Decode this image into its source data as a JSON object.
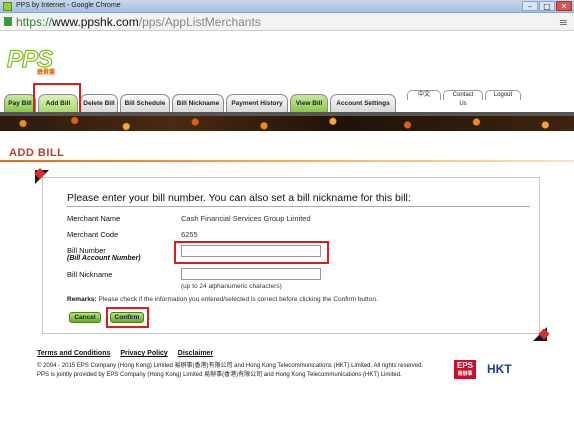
{
  "browser": {
    "window_title": "PPS by Internet - Google Chrome",
    "url_scheme": "https://",
    "url_host": "www.ppshk.com",
    "url_path": "/pps/AppListMerchants",
    "minimize": "–",
    "maximize": "□",
    "close": "✕"
  },
  "logo": {
    "text": "PPS",
    "cn": "繳費靈"
  },
  "util_tabs": [
    "中文",
    "Contact Us",
    "Logout"
  ],
  "nav_tabs": [
    {
      "label": "Pay Bill"
    },
    {
      "label": "Add Bill"
    },
    {
      "label": "Delete Bill"
    },
    {
      "label": "Bill Schedule"
    },
    {
      "label": "Bill Nickname"
    },
    {
      "label": "Payment History"
    },
    {
      "label": "View Bill"
    },
    {
      "label": "Account Settings"
    }
  ],
  "section_title": "ADD BILL",
  "form": {
    "heading": "Please enter your bill number. You can also set a bill nickname for this bill:",
    "merchant_name_label": "Merchant Name",
    "merchant_name": "Cash Financial Services Group Limited",
    "merchant_code_label": "Merchant Code",
    "merchant_code": "6255",
    "bill_number_label": "Bill Number",
    "bill_number_sub": "(Bill Account Number)",
    "bill_number_value": "",
    "bill_nickname_label": "Bill Nickname",
    "bill_nickname_value": "",
    "nickname_hint": "(up to 24 alphanumeric characters)",
    "remarks_label": "Remarks:",
    "remarks_text": "Please check if the information you entered/selected is correct before clicking the Confirm button.",
    "cancel": "Cancel",
    "confirm": "Confirm"
  },
  "footer": {
    "links": [
      "Terms and Conditions",
      "Privacy Policy",
      "Disclaimer"
    ],
    "copyright_1": "© 2004 - 2015 EPS Company (Hong Kong) Limited 易辦事(香港)有限公司 and Hong Kong Telecommunications (HKT) Limited. All rights reserved.",
    "copyright_2": "PPS is jointly provided by EPS Company (Hong Kong) Limited 易辦事(香港)有限公司 and Hong Kong Telecommunications (HKT) Limited.",
    "eps_logo": "EPS",
    "eps_logo_cn": "易辦事",
    "hkt_logo": "HKT"
  },
  "colors": {
    "accent_green": "#8cc63f",
    "accent_orange": "#e86a10",
    "title_red": "#c0392b",
    "highlight_red": "#d42020"
  }
}
